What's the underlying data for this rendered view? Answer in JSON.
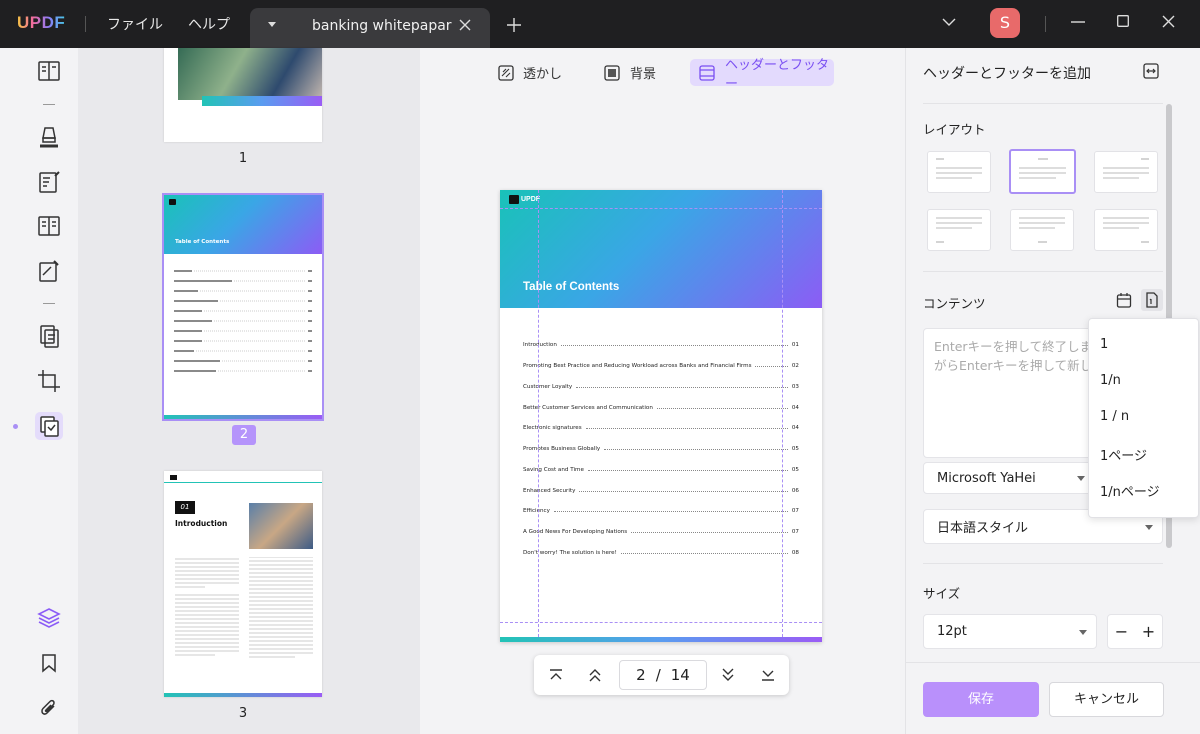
{
  "app": {
    "logo": "UPDF"
  },
  "menu": {
    "file": "ファイル",
    "help": "ヘルプ"
  },
  "tab": {
    "title": "banking whitepapar"
  },
  "user": {
    "avatar_letter": "S"
  },
  "thumbnails": [
    {
      "page_label": "1"
    },
    {
      "page_label": "2"
    },
    {
      "page_label": "3"
    }
  ],
  "thumb3": {
    "chapter_num": "01",
    "chapter_title": "Introduction"
  },
  "modes": {
    "watermark": "透かし",
    "background": "背景",
    "header_footer": "ヘッダーとフッター"
  },
  "page_preview": {
    "logo": "UPDF",
    "title": "Table of Contents",
    "toc": [
      {
        "label": "Introduction",
        "page": "01"
      },
      {
        "label": "Promoting Best Practice and Reducing Workload across Banks and Financial Firms",
        "page": "02"
      },
      {
        "label": "Customer Loyalty",
        "page": "03"
      },
      {
        "label": "Better Customer Services and Communication",
        "page": "04"
      },
      {
        "label": "Electronic signatures",
        "page": "04"
      },
      {
        "label": "Promotes Business Globally",
        "page": "05"
      },
      {
        "label": "Saving Cost and Time",
        "page": "05"
      },
      {
        "label": "Enhanced Security",
        "page": "06"
      },
      {
        "label": "Efficiency",
        "page": "07"
      },
      {
        "label": "A Good News For Developing Nations",
        "page": "07"
      },
      {
        "label": "Don't worry! The solution is here!",
        "page": "08"
      }
    ]
  },
  "pager": {
    "current": "2",
    "separator": "/",
    "total": "14"
  },
  "panel": {
    "title": "ヘッダーとフッターを追加",
    "layout_label": "レイアウト",
    "content_label": "コンテンツ",
    "content_placeholder": "Enterキーを押して終了します。しながらEnterキーを押して新し",
    "font": "Microsoft YaHei",
    "style": "日本語スタイル",
    "size_label": "サイズ",
    "size_value": "12pt",
    "minus": "−",
    "plus": "+",
    "save": "保存",
    "cancel": "キャンセル"
  },
  "page_number_formats": [
    "1",
    "1/n",
    "1 / n",
    "1ページ",
    "1/nページ"
  ],
  "colors": {
    "accent": "#8b5cf6",
    "save_button": "#b990fb",
    "avatar": "#e86a6a"
  }
}
